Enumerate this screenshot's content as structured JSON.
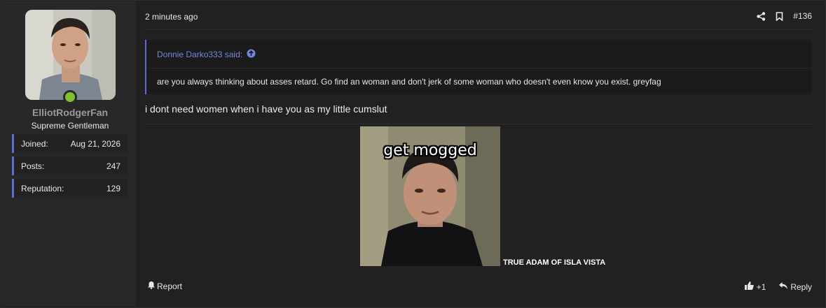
{
  "user": {
    "name": "ElliotRodgerFan",
    "title": "Supreme Gentleman",
    "online_color": "#7fc12e",
    "stats": [
      {
        "label": "Joined:",
        "value": "Aug 21, 2026"
      },
      {
        "label": "Posts:",
        "value": "247"
      },
      {
        "label": "Reputation:",
        "value": "129"
      }
    ]
  },
  "post": {
    "timestamp": "2 minutes ago",
    "number": "#136",
    "share_icon": "share-icon",
    "bookmark_icon": "bookmark-icon",
    "quote": {
      "author": "Donnie Darko333 said:",
      "text": "are you always thinking about asses retard. Go find an woman and don't jerk of some woman who doesn't even know you exist. greyfag"
    },
    "message": "i dont need women when i have you as my little cumslut",
    "image": {
      "overlay_text": "get mogged",
      "caption": "TRUE ADAM OF ISLA VISTA"
    }
  },
  "footer": {
    "report_label": "Report",
    "reaction_count": "+1",
    "reply_label": "Reply"
  },
  "colors": {
    "accent": "#5a6ed0",
    "quote_link": "#7187e0",
    "background": "#212121"
  }
}
